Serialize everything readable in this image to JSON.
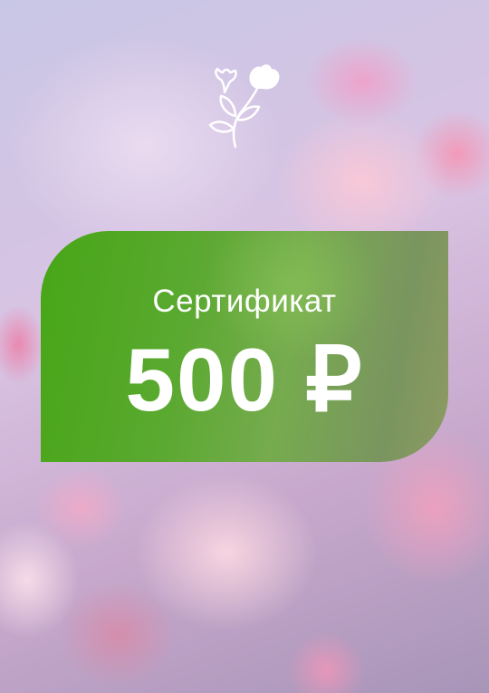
{
  "certificate": {
    "title": "Сертификат",
    "amount": "500 ₽",
    "logo_icon": "flower-icon",
    "card_color": "#4aa81a",
    "text_color": "#ffffff"
  }
}
